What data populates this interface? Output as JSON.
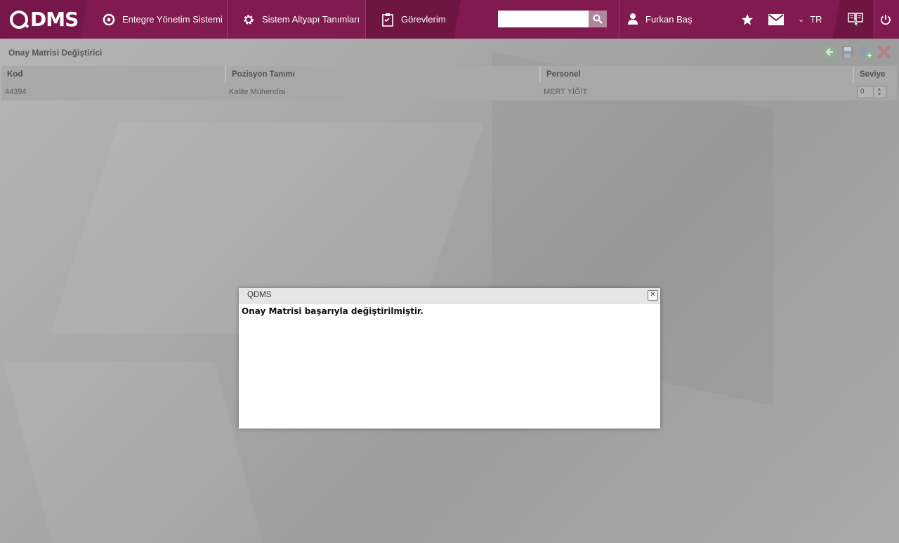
{
  "app": {
    "logo_text": "DMS",
    "brand_color": "#801a4f"
  },
  "nav": {
    "items": [
      {
        "label": "Entegre Yönetim Sistemi",
        "icon": "qdms-circle-icon"
      },
      {
        "label": "Sistem Altyapı Tanımları",
        "icon": "gear-icon"
      },
      {
        "label": "Görevlerim",
        "icon": "task-clipboard-icon"
      }
    ]
  },
  "search": {
    "value": "",
    "placeholder": ""
  },
  "user": {
    "name": "Furkan Baş"
  },
  "topbar": {
    "language": "TR"
  },
  "page": {
    "title": "Onay Matrisi Değiştirici",
    "columns": [
      "Kod",
      "Pozisyon Tanımı",
      "Personel",
      "Seviye"
    ],
    "rows": [
      {
        "kod": "44394",
        "pozisyon": "Kalite Mühendisi",
        "personel": "MERT YİĞİT",
        "seviye": "0"
      }
    ]
  },
  "dialog": {
    "title": "QDMS",
    "message": "Onay Matrisi başarıyla değiştirilmiştir."
  }
}
